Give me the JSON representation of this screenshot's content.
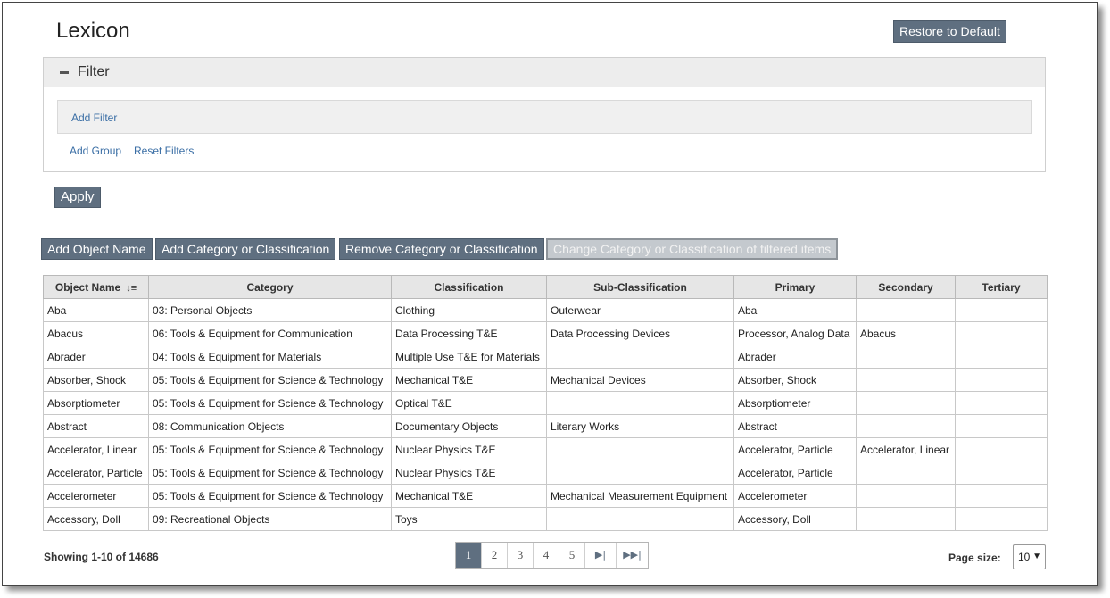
{
  "page": {
    "title": "Lexicon"
  },
  "header": {
    "restore_label": "Restore to Default"
  },
  "filter": {
    "title": "Filter",
    "add_filter_label": "Add Filter",
    "add_group_label": "Add Group",
    "reset_filters_label": "Reset Filters",
    "apply_label": "Apply"
  },
  "actions": {
    "add_object_name": "Add Object Name",
    "add_category": "Add Category or Classification",
    "remove_category": "Remove Category or Classification",
    "change_category": "Change Category or Classification of filtered items"
  },
  "table": {
    "columns": [
      "Object Name",
      "Category",
      "Classification",
      "Sub-Classification",
      "Primary",
      "Secondary",
      "Tertiary"
    ],
    "rows": [
      [
        "Aba",
        "03: Personal Objects",
        "Clothing",
        "Outerwear",
        "Aba",
        "",
        ""
      ],
      [
        "Abacus",
        "06: Tools & Equipment for Communication",
        "Data Processing T&E",
        "Data Processing Devices",
        "Processor, Analog Data",
        "Abacus",
        ""
      ],
      [
        "Abrader",
        "04: Tools & Equipment for Materials",
        "Multiple Use T&E for Materials",
        "",
        "Abrader",
        "",
        ""
      ],
      [
        "Absorber, Shock",
        "05: Tools & Equipment for Science & Technology",
        "Mechanical T&E",
        "Mechanical Devices",
        "Absorber, Shock",
        "",
        ""
      ],
      [
        "Absorptiometer",
        "05: Tools & Equipment for Science & Technology",
        "Optical T&E",
        "",
        "Absorptiometer",
        "",
        ""
      ],
      [
        "Abstract",
        "08: Communication Objects",
        "Documentary Objects",
        "Literary Works",
        "Abstract",
        "",
        ""
      ],
      [
        "Accelerator, Linear",
        "05: Tools & Equipment for Science & Technology",
        "Nuclear Physics T&E",
        "",
        "Accelerator, Particle",
        "Accelerator, Linear",
        ""
      ],
      [
        "Accelerator, Particle",
        "05: Tools & Equipment for Science & Technology",
        "Nuclear Physics T&E",
        "",
        "Accelerator, Particle",
        "",
        ""
      ],
      [
        "Accelerometer",
        "05: Tools & Equipment for Science & Technology",
        "Mechanical T&E",
        "Mechanical Measurement Equipment",
        "Accelerometer",
        "",
        ""
      ],
      [
        "Accessory, Doll",
        "09: Recreational Objects",
        "Toys",
        "",
        "Accessory, Doll",
        "",
        ""
      ]
    ]
  },
  "footer": {
    "showing": "Showing 1-10 of 14686",
    "pages": [
      "1",
      "2",
      "3",
      "4",
      "5"
    ],
    "page_size_label": "Page size:",
    "page_size_value": "10"
  },
  "icons": {
    "collapse": "minus-icon",
    "sort": "sort-ascending-icon",
    "next": "next-page-icon",
    "last": "last-page-icon",
    "dropdown": "chevron-down-icon"
  },
  "colors": {
    "button_bg": "#5f6f80",
    "link": "#3a6ea5",
    "header_bg": "#e6e6e6"
  }
}
